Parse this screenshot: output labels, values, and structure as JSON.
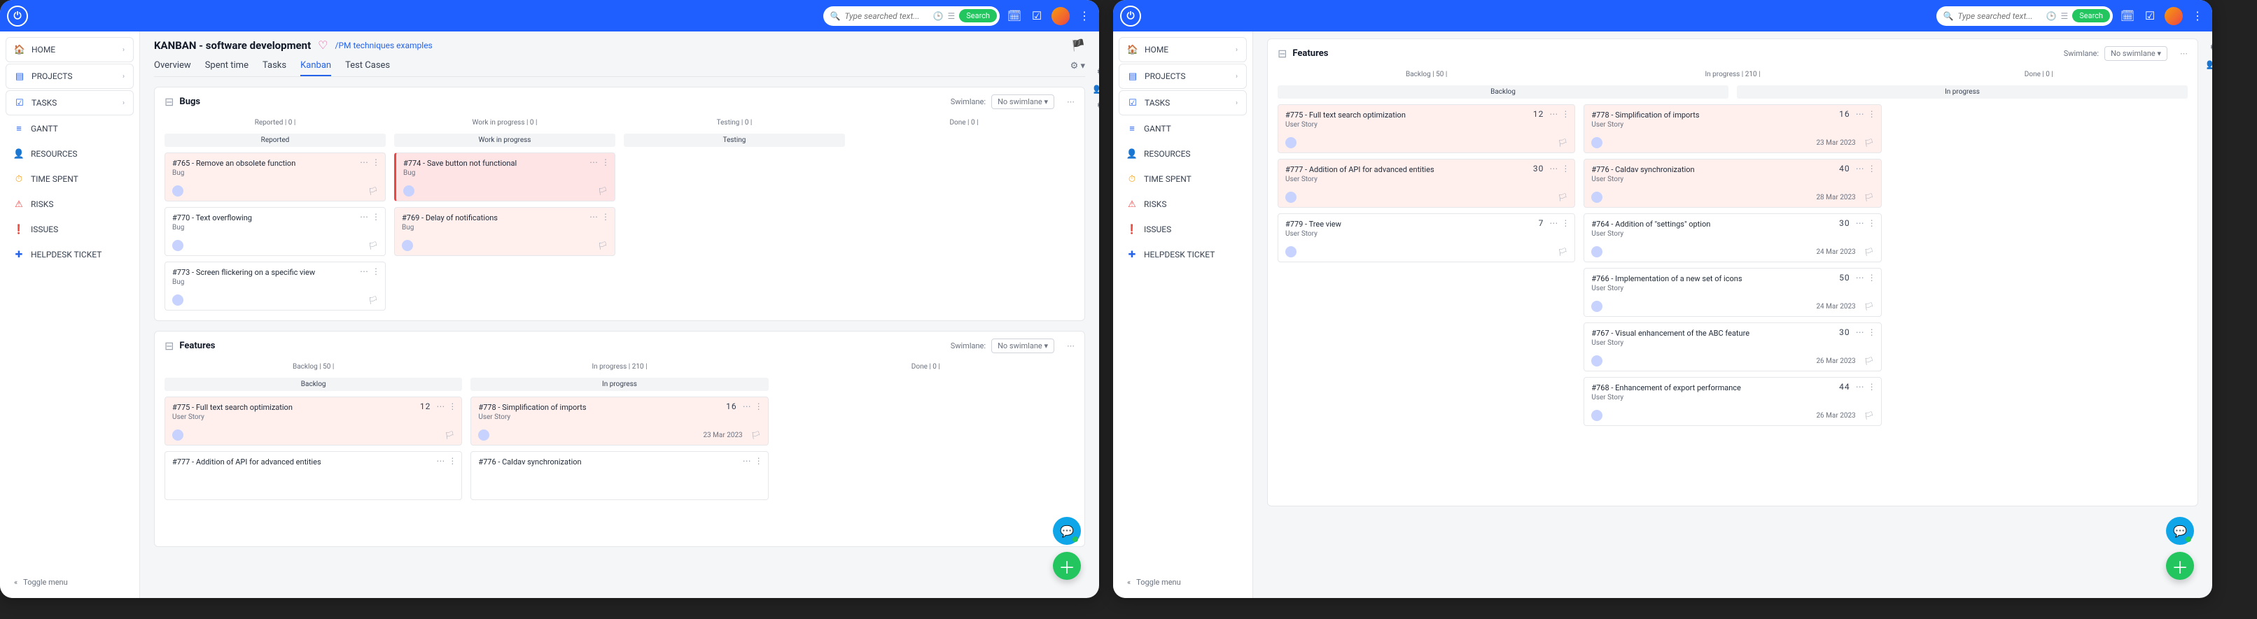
{
  "search": {
    "placeholder": "Type searched text...",
    "button": "Search"
  },
  "nav": [
    {
      "label": "HOME",
      "icon": "🏠",
      "chev": true,
      "color": "i-blue",
      "framed": true
    },
    {
      "label": "PROJECTS",
      "icon": "▤",
      "chev": true,
      "color": "i-blue",
      "framed": true
    },
    {
      "label": "TASKS",
      "icon": "☑",
      "chev": true,
      "color": "i-blue",
      "framed": true
    },
    {
      "label": "GANTT",
      "icon": "≡",
      "chev": false,
      "color": "i-blue",
      "framed": false
    },
    {
      "label": "RESOURCES",
      "icon": "👤",
      "chev": false,
      "color": "i-blue",
      "framed": false
    },
    {
      "label": "TIME SPENT",
      "icon": "⏱",
      "chev": false,
      "color": "i-orange",
      "framed": false
    },
    {
      "label": "RISKS",
      "icon": "⚠",
      "chev": false,
      "color": "i-red",
      "framed": false
    },
    {
      "label": "ISSUES",
      "icon": "❗",
      "chev": false,
      "color": "i-blue",
      "framed": false
    },
    {
      "label": "HELPDESK TICKET",
      "icon": "✚",
      "chev": false,
      "color": "i-blue",
      "framed": false
    }
  ],
  "toggle_menu": "Toggle menu",
  "left": {
    "title": "KANBAN - software development",
    "breadcrumb": "/PM techniques examples",
    "tabs": [
      "Overview",
      "Spent time",
      "Tasks",
      "Kanban",
      "Test Cases"
    ],
    "active_tab": 3,
    "swimlane_label": "Swimlane:",
    "swimlane_value": "No swimlane",
    "bugs": {
      "title": "Bugs",
      "cols": [
        "Reported | 0 |",
        "Work in progress | 0 |",
        "Testing | 0 |",
        "Done | 0 |"
      ],
      "subs": [
        "Reported",
        "Work in progress",
        "Testing",
        ""
      ],
      "reported": [
        {
          "title": "#765 - Remove an obsolete function",
          "type": "Bug",
          "cls": "pink"
        },
        {
          "title": "#770 - Text overflowing",
          "type": "Bug",
          "cls": "plain"
        },
        {
          "title": "#773 - Screen flickering on a specific view",
          "type": "Bug",
          "cls": "plain"
        }
      ],
      "wip": [
        {
          "title": "#774 - Save button not functional",
          "type": "Bug",
          "cls": "red"
        },
        {
          "title": "#769 - Delay of notifications",
          "type": "Bug",
          "cls": "pink"
        }
      ]
    },
    "features": {
      "title": "Features",
      "cols": [
        "Backlog | 50 |",
        "In progress | 210 |",
        "Done | 0 |"
      ],
      "subs": [
        "Backlog",
        "In progress",
        ""
      ],
      "backlog": [
        {
          "title": "#775 - Full text search optimization",
          "type": "User Story",
          "num": "12",
          "cls": "pink"
        },
        {
          "title": "#777 - Addition of API for advanced entities",
          "type": "",
          "num": "",
          "cls": "plain",
          "partial": true
        }
      ],
      "inprog": [
        {
          "title": "#778 - Simplification of imports",
          "type": "User Story",
          "num": "16",
          "cls": "pink",
          "date": "23 Mar 2023"
        },
        {
          "title": "#776 - Caldav synchronization",
          "type": "",
          "cls": "plain",
          "partial": true
        }
      ]
    }
  },
  "right": {
    "features": {
      "title": "Features",
      "swimlane_label": "Swimlane:",
      "swimlane_value": "No swimlane",
      "cols": [
        "Backlog | 50 |",
        "In progress | 210 |",
        "Done | 0 |"
      ],
      "subs": [
        "Backlog",
        "In progress"
      ],
      "backlog": [
        {
          "title": "#775 - Full text search optimization",
          "type": "User Story",
          "num": "12",
          "cls": "pink"
        },
        {
          "title": "#777 - Addition of API for advanced entities",
          "type": "User Story",
          "num": "30",
          "cls": "pink"
        },
        {
          "title": "#779 - Tree view",
          "type": "User Story",
          "num": "7",
          "cls": "plain"
        }
      ],
      "inprog": [
        {
          "title": "#778 - Simplification of imports",
          "type": "User Story",
          "num": "16",
          "cls": "pink",
          "date": "23 Mar 2023"
        },
        {
          "title": "#776 - Caldav synchronization",
          "type": "User Story",
          "num": "40",
          "cls": "pink",
          "date": "28 Mar 2023"
        },
        {
          "title": "#764 - Addition of \"settings\" option",
          "type": "User Story",
          "num": "30",
          "cls": "plain",
          "date": "24 Mar 2023"
        },
        {
          "title": "#766 - Implementation of a new set of icons",
          "type": "User Story",
          "num": "50",
          "cls": "plain",
          "date": "24 Mar 2023"
        },
        {
          "title": "#767 - Visual enhancement of the ABC feature",
          "type": "User Story",
          "num": "30",
          "cls": "plain",
          "date": "26 Mar 2023"
        },
        {
          "title": "#768 - Enhancement of export performance",
          "type": "User Story",
          "num": "44",
          "cls": "plain",
          "date": "26 Mar 2023"
        }
      ]
    }
  }
}
